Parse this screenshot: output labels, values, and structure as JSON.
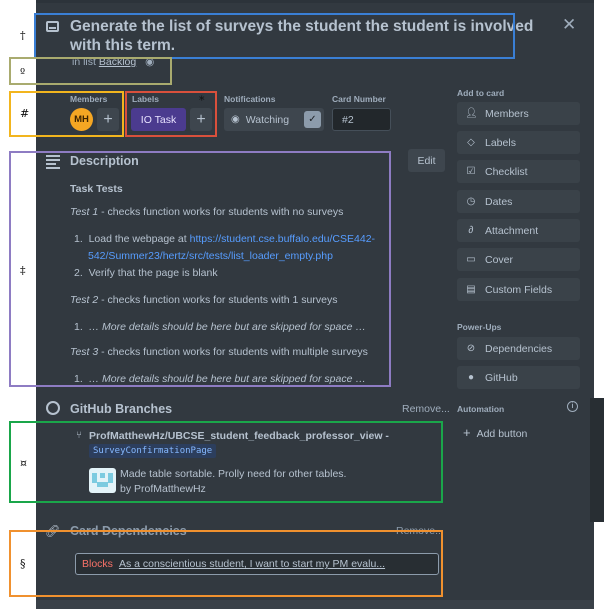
{
  "title": "Generate the list of surveys the student the student is involved with this term.",
  "title_line1": "Generate the list of surveys the student the student is involved",
  "title_line2": "with this term.",
  "list_prefix": "in list",
  "list_name": "Backlog",
  "members": {
    "label": "Members",
    "initials": "MH"
  },
  "labels": {
    "label": "Labels",
    "chip": "IO Task"
  },
  "notifications": {
    "label": "Notifications",
    "button": "Watching"
  },
  "card_number": {
    "label": "Card Number",
    "value": "#2"
  },
  "description": {
    "heading": "Description",
    "edit": "Edit",
    "subheading": "Task Tests",
    "test1_label": "Test 1",
    "test1_text": " - checks function works for students with no surveys",
    "step1_prefix": "Load the webpage at ",
    "step1_link_a": "https://student.cse.buffalo.edu/CSE442-",
    "step1_link_b": "542/Summer23/hertz/src/tests/list_loader_empty.php",
    "step2": "Verify that the page is blank",
    "test2_label": "Test 2",
    "test2_text": " - checks function works for students with 1 surveys",
    "skip_note": "… More details should be here but are skipped for space …",
    "test3_label": "Test 3",
    "test3_text": " - checks function works for students with multiple surveys"
  },
  "github": {
    "heading": "GitHub Branches",
    "remove": "Remove...",
    "branch": "ProfMatthewHz/UBCSE_student_feedback_professor_view -",
    "branch_tag": "SurveyConfirmationPage",
    "commit_line1": "Made table sortable. Prolly need for other tables.",
    "commit_line2": "by ProfMatthewHz"
  },
  "dependencies": {
    "heading": "Card Dependencies",
    "remove": "Remove...",
    "type": "Blocks",
    "card": "As a conscientious student, I want to start my PM evalu..."
  },
  "sidebar": {
    "add_to_card": "Add to card",
    "buttons": [
      "Members",
      "Labels",
      "Checklist",
      "Dates",
      "Attachment",
      "Cover",
      "Custom Fields"
    ],
    "power_ups": "Power-Ups",
    "power_buttons": [
      "Dependencies",
      "GitHub"
    ],
    "automation": "Automation",
    "add_button": "Add button"
  },
  "annotation_marks": [
    "†",
    "º",
    "#",
    "*",
    "‡",
    "¤",
    "§"
  ],
  "colors": {
    "card_bg": "#323940",
    "label_purple": "#4b3b8f",
    "link_blue": "#579dff",
    "blocks_red": "#f87168",
    "box_blue": "#3a7fd5",
    "box_olive": "#a9ab6f",
    "box_yellow": "#f2b51e",
    "box_red": "#d9503c",
    "box_purple": "#8e7cc3",
    "box_green": "#1aa64a",
    "box_orange": "#f0912f"
  }
}
